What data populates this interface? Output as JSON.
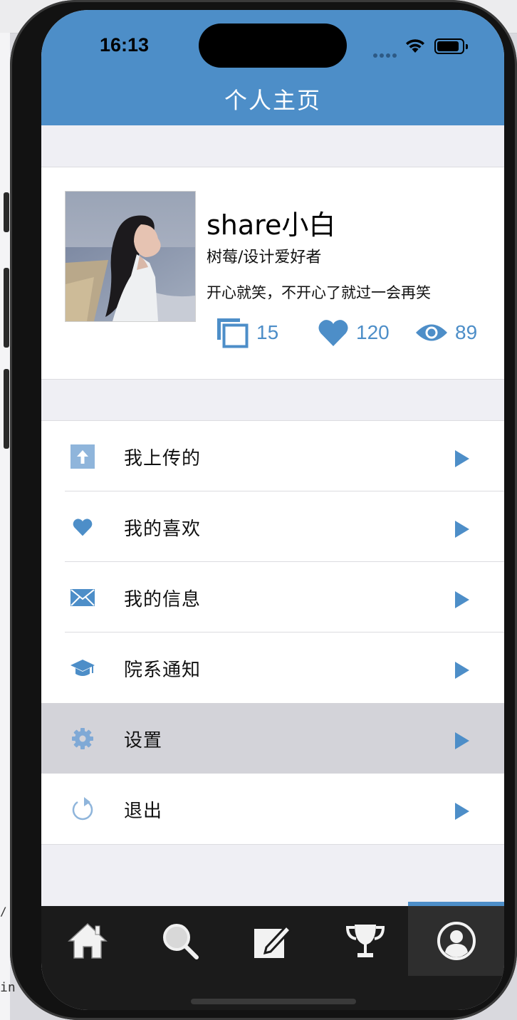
{
  "status_bar": {
    "time": "16:13"
  },
  "navbar": {
    "title": "个人主页"
  },
  "profile": {
    "name": "share小白",
    "role": "树莓/设计爱好者",
    "motto": "开心就笑，不开心了就过一会再笑",
    "stats": {
      "uploads": "15",
      "likes": "120",
      "views": "89"
    }
  },
  "menu": {
    "items": [
      {
        "label": "我上传的",
        "icon": "upload-icon"
      },
      {
        "label": "我的喜欢",
        "icon": "heart-icon"
      },
      {
        "label": "我的信息",
        "icon": "mail-icon"
      },
      {
        "label": "院系通知",
        "icon": "graduation-cap-icon"
      },
      {
        "label": "设置",
        "icon": "gear-icon",
        "active": true
      },
      {
        "label": "退出",
        "icon": "refresh-icon"
      }
    ]
  },
  "tabbar": {
    "tabs": [
      {
        "icon": "home-icon"
      },
      {
        "icon": "search-icon"
      },
      {
        "icon": "edit-icon"
      },
      {
        "icon": "trophy-icon"
      },
      {
        "icon": "user-icon",
        "selected": true
      }
    ]
  },
  "colors": {
    "accent": "#4d8ec8",
    "background": "#efeff4",
    "tabbar": "#1b1b1b",
    "active_row": "#d3d3d9"
  },
  "desktop": {
    "left_text_1": "/",
    "left_text_2": "in"
  }
}
